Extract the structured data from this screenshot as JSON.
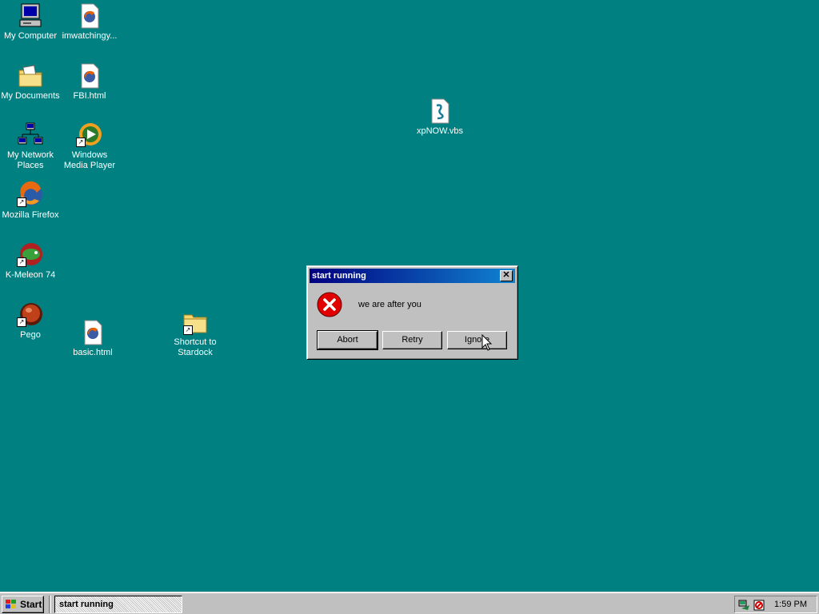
{
  "desktop": {
    "background": "#008080",
    "icons": [
      {
        "label": "My Computer",
        "icon": "computer-icon"
      },
      {
        "label": "imwatchingy...",
        "icon": "firefox-html-icon"
      },
      {
        "label": "My Documents",
        "icon": "folder-documents-icon"
      },
      {
        "label": "FBI.html",
        "icon": "firefox-html-icon"
      },
      {
        "label": "My Network Places",
        "icon": "network-icon"
      },
      {
        "label": "Windows Media Player",
        "icon": "media-player-icon"
      },
      {
        "label": "Mozilla Firefox",
        "icon": "firefox-icon"
      },
      {
        "label": "K-Meleon 74",
        "icon": "kmeleon-icon"
      },
      {
        "label": "Pego",
        "icon": "pego-icon"
      },
      {
        "label": "basic.html",
        "icon": "firefox-html-icon"
      },
      {
        "label": "Shortcut to Stardock",
        "icon": "folder-icon"
      },
      {
        "label": "xpNOW.vbs",
        "icon": "vbs-script-icon"
      }
    ]
  },
  "dialog": {
    "title": "start running",
    "message": "we are after you",
    "icon": "error-icon",
    "buttons": {
      "abort": "Abort",
      "retry": "Retry",
      "ignore": "Ignore"
    }
  },
  "taskbar": {
    "start_label": "Start",
    "tasks": [
      {
        "label": "start running"
      }
    ],
    "clock": "1:59 PM",
    "tray_icons": [
      "network-tray-icon",
      "security-tray-icon"
    ]
  }
}
